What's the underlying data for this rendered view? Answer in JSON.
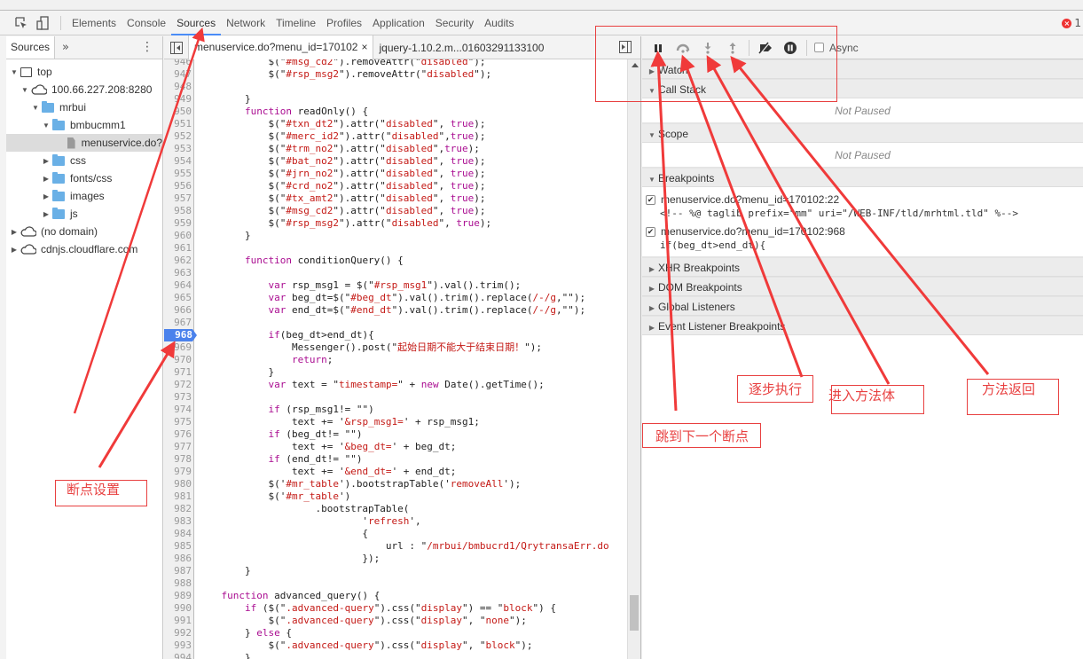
{
  "devtools": {
    "main_tabs": [
      "Elements",
      "Console",
      "Sources",
      "Network",
      "Timeline",
      "Profiles",
      "Application",
      "Security",
      "Audits"
    ],
    "active_tab": "Sources",
    "error_count": "1",
    "accent_color": "#4a8cf7"
  },
  "navigator": {
    "tab_label": "Sources",
    "more_label": "»",
    "kebab_label": "⋮",
    "tree": [
      {
        "label": "top",
        "type": "frame",
        "expanded": true,
        "depth": 0
      },
      {
        "label": "100.66.227.208:8280",
        "type": "domain",
        "expanded": true,
        "depth": 1
      },
      {
        "label": "mrbui",
        "type": "folder",
        "expanded": true,
        "depth": 2
      },
      {
        "label": "bmbucmm1",
        "type": "folder",
        "expanded": true,
        "depth": 3
      },
      {
        "label": "menuservice.do?",
        "type": "file",
        "selected": true,
        "depth": 4
      },
      {
        "label": "css",
        "type": "folder",
        "expanded": false,
        "depth": 3
      },
      {
        "label": "fonts/css",
        "type": "folder",
        "expanded": false,
        "depth": 3
      },
      {
        "label": "images",
        "type": "folder",
        "expanded": false,
        "depth": 3
      },
      {
        "label": "js",
        "type": "folder",
        "expanded": false,
        "depth": 3
      },
      {
        "label": "(no domain)",
        "type": "domain",
        "expanded": false,
        "depth": 0
      },
      {
        "label": "cdnjs.cloudflare.com",
        "type": "domain",
        "expanded": false,
        "depth": 0
      }
    ]
  },
  "editor": {
    "tabs": [
      {
        "label": "menuservice.do?menu_id=170102",
        "active": true,
        "close": "×"
      },
      {
        "label": "jquery-1.10.2.m...01603291133100",
        "active": false
      }
    ],
    "breakpoint_line": 968,
    "scroll_position": 0.95,
    "lines": [
      {
        "n": 946,
        "code": [
          [
            "",
            "            $(\""
          ],
          [
            "str",
            "#msg_cd2"
          ],
          [
            "",
            "\").removeAttr(\""
          ],
          [
            "str",
            "disabled"
          ],
          [
            "",
            "\");"
          ]
        ]
      },
      {
        "n": 947,
        "code": [
          [
            "",
            "            $(\""
          ],
          [
            "str",
            "#rsp_msg2"
          ],
          [
            "",
            "\").removeAttr(\""
          ],
          [
            "str",
            "disabled"
          ],
          [
            "",
            "\");"
          ]
        ]
      },
      {
        "n": 948,
        "code": [
          [
            "",
            ""
          ]
        ]
      },
      {
        "n": 949,
        "code": [
          [
            "",
            "        }"
          ]
        ]
      },
      {
        "n": 950,
        "code": [
          [
            "",
            "        "
          ],
          [
            "kw",
            "function"
          ],
          [
            "",
            " readOnly() {"
          ]
        ]
      },
      {
        "n": 951,
        "code": [
          [
            "",
            "            $(\""
          ],
          [
            "str",
            "#txn_dt2"
          ],
          [
            "",
            "\").attr(\""
          ],
          [
            "str",
            "disabled"
          ],
          [
            "",
            "\", "
          ],
          [
            "kw",
            "true"
          ],
          [
            "",
            ");"
          ]
        ]
      },
      {
        "n": 952,
        "code": [
          [
            "",
            "            $(\""
          ],
          [
            "str",
            "#merc_id2"
          ],
          [
            "",
            "\").attr(\""
          ],
          [
            "str",
            "disabled"
          ],
          [
            "",
            "\","
          ],
          [
            "kw",
            "true"
          ],
          [
            "",
            ");"
          ]
        ]
      },
      {
        "n": 953,
        "code": [
          [
            "",
            "            $(\""
          ],
          [
            "str",
            "#trm_no2"
          ],
          [
            "",
            "\").attr(\""
          ],
          [
            "str",
            "disabled"
          ],
          [
            "",
            "\","
          ],
          [
            "kw",
            "true"
          ],
          [
            "",
            ");"
          ]
        ]
      },
      {
        "n": 954,
        "code": [
          [
            "",
            "            $(\""
          ],
          [
            "str",
            "#bat_no2"
          ],
          [
            "",
            "\").attr(\""
          ],
          [
            "str",
            "disabled"
          ],
          [
            "",
            "\", "
          ],
          [
            "kw",
            "true"
          ],
          [
            "",
            ");"
          ]
        ]
      },
      {
        "n": 955,
        "code": [
          [
            "",
            "            $(\""
          ],
          [
            "str",
            "#jrn_no2"
          ],
          [
            "",
            "\").attr(\""
          ],
          [
            "str",
            "disabled"
          ],
          [
            "",
            "\", "
          ],
          [
            "kw",
            "true"
          ],
          [
            "",
            ");"
          ]
        ]
      },
      {
        "n": 956,
        "code": [
          [
            "",
            "            $(\""
          ],
          [
            "str",
            "#crd_no2"
          ],
          [
            "",
            "\").attr(\""
          ],
          [
            "str",
            "disabled"
          ],
          [
            "",
            "\", "
          ],
          [
            "kw",
            "true"
          ],
          [
            "",
            ");"
          ]
        ]
      },
      {
        "n": 957,
        "code": [
          [
            "",
            "            $(\""
          ],
          [
            "str",
            "#tx_amt2"
          ],
          [
            "",
            "\").attr(\""
          ],
          [
            "str",
            "disabled"
          ],
          [
            "",
            "\", "
          ],
          [
            "kw",
            "true"
          ],
          [
            "",
            ");"
          ]
        ]
      },
      {
        "n": 958,
        "code": [
          [
            "",
            "            $(\""
          ],
          [
            "str",
            "#msg_cd2"
          ],
          [
            "",
            "\").attr(\""
          ],
          [
            "str",
            "disabled"
          ],
          [
            "",
            "\", "
          ],
          [
            "kw",
            "true"
          ],
          [
            "",
            ");"
          ]
        ]
      },
      {
        "n": 959,
        "code": [
          [
            "",
            "            $(\""
          ],
          [
            "str",
            "#rsp_msg2"
          ],
          [
            "",
            "\").attr(\""
          ],
          [
            "str",
            "disabled"
          ],
          [
            "",
            "\", "
          ],
          [
            "kw",
            "true"
          ],
          [
            "",
            ");"
          ]
        ]
      },
      {
        "n": 960,
        "code": [
          [
            "",
            "        }"
          ]
        ]
      },
      {
        "n": 961,
        "code": [
          [
            "",
            ""
          ]
        ]
      },
      {
        "n": 962,
        "code": [
          [
            "",
            "        "
          ],
          [
            "kw",
            "function"
          ],
          [
            "",
            " conditionQuery() {"
          ]
        ]
      },
      {
        "n": 963,
        "code": [
          [
            "",
            ""
          ]
        ]
      },
      {
        "n": 964,
        "code": [
          [
            "",
            "            "
          ],
          [
            "kw",
            "var"
          ],
          [
            "",
            " rsp_msg1 = $(\""
          ],
          [
            "str",
            "#rsp_msg1"
          ],
          [
            "",
            "\").val().trim();"
          ]
        ]
      },
      {
        "n": 965,
        "code": [
          [
            "",
            "            "
          ],
          [
            "kw",
            "var"
          ],
          [
            "",
            " beg_dt=$(\""
          ],
          [
            "str",
            "#beg_dt"
          ],
          [
            "",
            "\").val().trim().replace("
          ],
          [
            "str",
            "/-/g"
          ],
          [
            "",
            ",\"\");"
          ]
        ]
      },
      {
        "n": 966,
        "code": [
          [
            "",
            "            "
          ],
          [
            "kw",
            "var"
          ],
          [
            "",
            " end_dt=$(\""
          ],
          [
            "str",
            "#end_dt"
          ],
          [
            "",
            "\").val().trim().replace("
          ],
          [
            "str",
            "/-/g"
          ],
          [
            "",
            ",\"\");"
          ]
        ]
      },
      {
        "n": 967,
        "code": [
          [
            "",
            ""
          ]
        ]
      },
      {
        "n": 968,
        "code": [
          [
            "",
            "            "
          ],
          [
            "kw",
            "if"
          ],
          [
            "",
            "(beg_dt>end_dt){"
          ]
        ]
      },
      {
        "n": 969,
        "code": [
          [
            "",
            "                Messenger().post(\""
          ],
          [
            "str",
            "起始日期不能大于结束日期！"
          ],
          [
            "",
            "\");"
          ]
        ]
      },
      {
        "n": 970,
        "code": [
          [
            "",
            "                "
          ],
          [
            "kw",
            "return"
          ],
          [
            "",
            ";"
          ]
        ]
      },
      {
        "n": 971,
        "code": [
          [
            "",
            "            }"
          ]
        ]
      },
      {
        "n": 972,
        "code": [
          [
            "",
            "            "
          ],
          [
            "kw",
            "var"
          ],
          [
            "",
            " text = \""
          ],
          [
            "str",
            "timestamp="
          ],
          [
            "",
            "\" + "
          ],
          [
            "kw",
            "new"
          ],
          [
            "",
            " Date().getTime();"
          ]
        ]
      },
      {
        "n": 973,
        "code": [
          [
            "",
            ""
          ]
        ]
      },
      {
        "n": 974,
        "code": [
          [
            "",
            "            "
          ],
          [
            "kw",
            "if"
          ],
          [
            "",
            " (rsp_msg1!= \"\")"
          ]
        ]
      },
      {
        "n": 975,
        "code": [
          [
            "",
            "                text += '"
          ],
          [
            "str",
            "&rsp_msg1="
          ],
          [
            "",
            "' + rsp_msg1;"
          ]
        ]
      },
      {
        "n": 976,
        "code": [
          [
            "",
            "            "
          ],
          [
            "kw",
            "if"
          ],
          [
            "",
            " (beg_dt!= \"\")"
          ]
        ]
      },
      {
        "n": 977,
        "code": [
          [
            "",
            "                text += '"
          ],
          [
            "str",
            "&beg_dt="
          ],
          [
            "",
            "' + beg_dt;"
          ]
        ]
      },
      {
        "n": 978,
        "code": [
          [
            "",
            "            "
          ],
          [
            "kw",
            "if"
          ],
          [
            "",
            " (end_dt!= \"\")"
          ]
        ]
      },
      {
        "n": 979,
        "code": [
          [
            "",
            "                text += '"
          ],
          [
            "str",
            "&end_dt="
          ],
          [
            "",
            "' + end_dt;"
          ]
        ]
      },
      {
        "n": 980,
        "code": [
          [
            "",
            "            $('"
          ],
          [
            "str",
            "#mr_table"
          ],
          [
            "",
            "').bootstrapTable('"
          ],
          [
            "str",
            "removeAll"
          ],
          [
            "",
            "');"
          ]
        ]
      },
      {
        "n": 981,
        "code": [
          [
            "",
            "            $('"
          ],
          [
            "str",
            "#mr_table"
          ],
          [
            "",
            "')"
          ]
        ]
      },
      {
        "n": 982,
        "code": [
          [
            "",
            "                    .bootstrapTable("
          ]
        ]
      },
      {
        "n": 983,
        "code": [
          [
            "",
            "                            '"
          ],
          [
            "str",
            "refresh"
          ],
          [
            "",
            "',"
          ]
        ]
      },
      {
        "n": 984,
        "code": [
          [
            "",
            "                            {"
          ]
        ]
      },
      {
        "n": 985,
        "code": [
          [
            "",
            "                                url : \""
          ],
          [
            "str",
            "/mrbui/bmbucrd1/QrytransaErr.do"
          ]
        ]
      },
      {
        "n": 986,
        "code": [
          [
            "",
            "                            });"
          ]
        ]
      },
      {
        "n": 987,
        "code": [
          [
            "",
            "        }"
          ]
        ]
      },
      {
        "n": 988,
        "code": [
          [
            "",
            ""
          ]
        ]
      },
      {
        "n": 989,
        "code": [
          [
            "",
            "    "
          ],
          [
            "kw",
            "function"
          ],
          [
            "",
            " advanced_query() {"
          ]
        ]
      },
      {
        "n": 990,
        "code": [
          [
            "",
            "        "
          ],
          [
            "kw",
            "if"
          ],
          [
            "",
            " ($(\""
          ],
          [
            "str",
            ".advanced-query"
          ],
          [
            "",
            "\").css(\""
          ],
          [
            "str",
            "display"
          ],
          [
            "",
            "\") == \""
          ],
          [
            "str",
            "block"
          ],
          [
            "",
            "\") {"
          ]
        ]
      },
      {
        "n": 991,
        "code": [
          [
            "",
            "            $(\""
          ],
          [
            "str",
            ".advanced-query"
          ],
          [
            "",
            "\").css(\""
          ],
          [
            "str",
            "display"
          ],
          [
            "",
            "\", \""
          ],
          [
            "str",
            "none"
          ],
          [
            "",
            "\");"
          ]
        ]
      },
      {
        "n": 992,
        "code": [
          [
            "",
            "        } "
          ],
          [
            "kw",
            "else"
          ],
          [
            "",
            " {"
          ]
        ]
      },
      {
        "n": 993,
        "code": [
          [
            "",
            "            $(\""
          ],
          [
            "str",
            ".advanced-query"
          ],
          [
            "",
            "\").css(\""
          ],
          [
            "str",
            "display"
          ],
          [
            "",
            "\", \""
          ],
          [
            "str",
            "block"
          ],
          [
            "",
            "\");"
          ]
        ]
      },
      {
        "n": 994,
        "code": [
          [
            "",
            "        }"
          ]
        ]
      }
    ]
  },
  "debugger": {
    "toolbar": {
      "pause": "pause-resume",
      "step_over": "step-over",
      "step_into": "step-into",
      "step_out": "step-out",
      "deactivate": "deactivate-breakpoints",
      "pause_exceptions": "pause-on-exceptions",
      "async_label": "Async",
      "async_checked": false
    },
    "sections": {
      "watch": "Watch",
      "call_stack": "Call Stack",
      "call_stack_status": "Not Paused",
      "scope": "Scope",
      "scope_status": "Not Paused",
      "breakpoints": "Breakpoints",
      "xhr": "XHR Breakpoints",
      "dom": "DOM Breakpoints",
      "global": "Global Listeners",
      "event": "Event Listener Breakpoints"
    },
    "breakpoints": [
      {
        "location": "menuservice.do?menu_id=170102:22",
        "code": "<!-- %@ taglib prefix=\"mm\" uri=\"/WEB-INF/tld/mrhtml.tld\" %-->",
        "checked": true
      },
      {
        "location": "menuservice.do?menu_id=170102:968",
        "code": "if(beg_dt>end_dt){",
        "checked": true
      }
    ]
  },
  "annotations": {
    "color": "#e84040",
    "breakpoint_setting": "断点设置",
    "next_breakpoint": "跳到下一个断点",
    "step_over": "逐步执行",
    "step_into": "进入方法体",
    "step_out": "方法返回"
  }
}
